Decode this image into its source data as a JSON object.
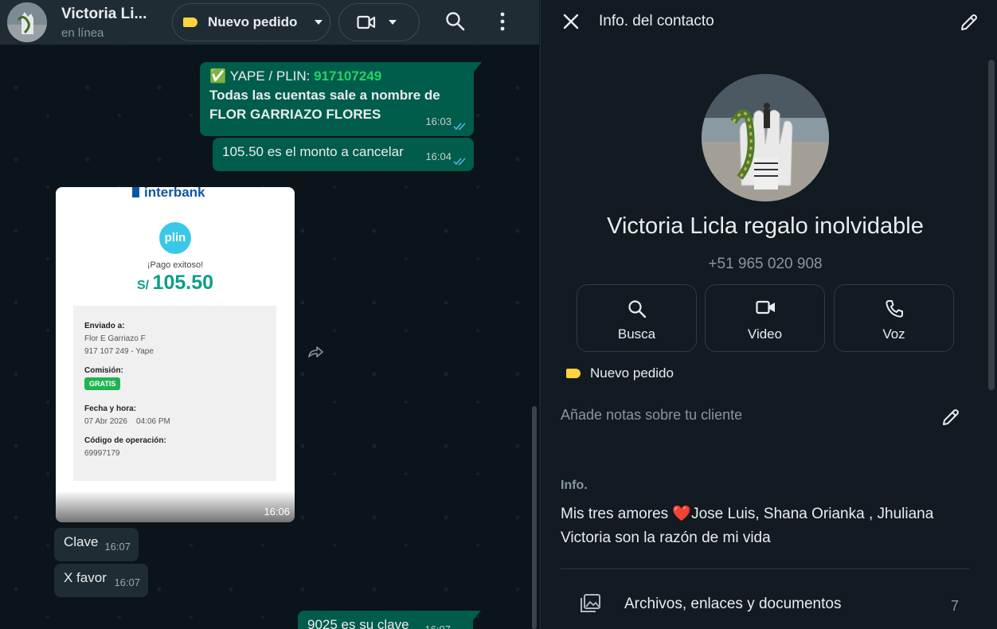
{
  "chat_header": {
    "name": "Victoria Li...",
    "status": "en línea",
    "label": "Nuevo pedido",
    "label_color": "#ffd23f"
  },
  "messages": [
    {
      "dir": "out",
      "emoji": "✅",
      "line1_prefix": "YAPE / PLIN: ",
      "line1_number": "917107249",
      "line2": "Todas las cuentas sale a nombre de",
      "line3": "FLOR GARRIAZO FLORES",
      "time": "16:03"
    },
    {
      "dir": "out",
      "text": "105.50 es el monto a cancelar",
      "time": "16:04"
    },
    {
      "dir": "in",
      "type": "image",
      "time": "16:06"
    },
    {
      "dir": "in",
      "text": "Clave",
      "time": "16:07"
    },
    {
      "dir": "in",
      "text": "X favor",
      "time": "16:07"
    },
    {
      "dir": "out",
      "text": "9025 es su clave",
      "time": "16:07"
    }
  ],
  "receipt": {
    "bank": "Interbank",
    "app": "plin",
    "status": "¡Pago exitoso!",
    "currency": "S/",
    "amount": "105.50",
    "sent_to_label": "Enviado a:",
    "sent_to_name": "Flor E Garriazo F",
    "sent_to_phone": "917 107 249 - Yape",
    "fee_label": "Comisión:",
    "fee_value": "GRATIS",
    "date_label": "Fecha y hora:",
    "date_value": "07 Abr 2026    04:06 PM",
    "op_label": "Código de operación:",
    "op_value": "69997179"
  },
  "contact_info": {
    "title": "Info. del contacto",
    "name": "Victoria Licla regalo inolvidable",
    "phone": "+51 965 020 908",
    "actions": [
      {
        "label": "Busca",
        "icon": "search-icon"
      },
      {
        "label": "Video",
        "icon": "video-icon"
      },
      {
        "label": "Voz",
        "icon": "phone-icon"
      }
    ],
    "label": "Nuevo pedido",
    "notes_placeholder": "Añade notas sobre tu cliente",
    "about_heading": "Info.",
    "about_part1": "Mis tres amores ",
    "about_heart": "❤️",
    "about_part2": "Jose Luis, Shana Orianka , Jhuliana Victoria son la razón de mi vida",
    "media_label": "Archivos, enlaces y documentos",
    "media_count": "7"
  },
  "colors": {
    "outgoing_bubble": "#005c4b",
    "incoming_bubble": "#202c33",
    "accent_green": "#25d366"
  }
}
